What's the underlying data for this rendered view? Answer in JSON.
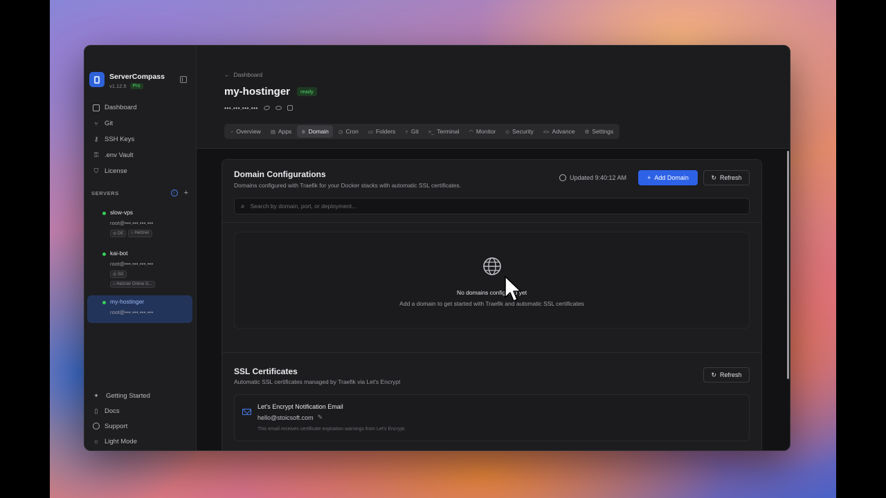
{
  "app": {
    "name": "ServerCompass",
    "version": "v1.12.5",
    "plan_badge": "Pro"
  },
  "sidebar": {
    "nav": [
      {
        "label": "Dashboard",
        "icon": "dashboard-icon"
      },
      {
        "label": "Git",
        "icon": "git-icon"
      },
      {
        "label": "SSH Keys",
        "icon": "key-icon"
      },
      {
        "label": ".env Vault",
        "icon": "vault-icon"
      },
      {
        "label": "License",
        "icon": "shield-icon"
      }
    ],
    "servers_label": "SERVERS",
    "servers": [
      {
        "name": "slow-vps",
        "host": "root@•••.•••.•••.•••",
        "tags": [
          "DE",
          "Hetzner"
        ],
        "status": "online"
      },
      {
        "name": "kai-bot",
        "host": "root@•••.•••.•••.•••",
        "tags": [
          "SG",
          "Hetzner Online G..."
        ],
        "status": "online"
      },
      {
        "name": "my-hostinger",
        "host": "root@•••.•••.•••.•••",
        "tags": [],
        "status": "online",
        "active": true
      }
    ],
    "bottom": [
      {
        "label": "Getting Started",
        "icon": "sparkle-icon"
      },
      {
        "label": "Docs",
        "icon": "book-icon"
      },
      {
        "label": "Support",
        "icon": "chat-icon"
      },
      {
        "label": "Light Mode",
        "icon": "sun-icon"
      }
    ]
  },
  "header": {
    "breadcrumb": "Dashboard",
    "title": "my-hostinger",
    "status": "ready",
    "ip": "•••.•••.•••.•••"
  },
  "tabs": [
    {
      "label": "Overview",
      "icon": "~"
    },
    {
      "label": "Apps",
      "icon": "▤"
    },
    {
      "label": "Domain",
      "icon": "⊕",
      "active": true
    },
    {
      "label": "Cron",
      "icon": "◷"
    },
    {
      "label": "Folders",
      "icon": "▭"
    },
    {
      "label": "Git",
      "icon": "⑂"
    },
    {
      "label": "Terminal",
      "icon": ">_"
    },
    {
      "label": "Monitor",
      "icon": "◠"
    },
    {
      "label": "Security",
      "icon": "◇"
    },
    {
      "label": "Advance",
      "icon": "<>"
    },
    {
      "label": "Settings",
      "icon": "⚙"
    }
  ],
  "domains": {
    "title": "Domain Configurations",
    "subtitle": "Domains configured with Traefik for your Docker stacks with automatic SSL certificates.",
    "updated": "Updated 9:40:12 AM",
    "add_label": "Add Domain",
    "refresh_label": "Refresh",
    "search_placeholder": "Search by domain, port, or deployment...",
    "empty_title": "No domains configured yet",
    "empty_subtitle": "Add a domain to get started with Traefik and automatic SSL certificates"
  },
  "ssl": {
    "title": "SSL Certificates",
    "subtitle": "Automatic SSL certificates managed by Traefik via Let's Encrypt",
    "refresh_label": "Refresh",
    "email_label": "Let's Encrypt Notification Email",
    "email": "hello@stoicsoft.com",
    "email_note": "This email receives certificate expiration warnings from Let's Encrypt."
  },
  "colors": {
    "accent": "#2e62e6",
    "online": "#34d058",
    "ready": "#4fd16a"
  }
}
